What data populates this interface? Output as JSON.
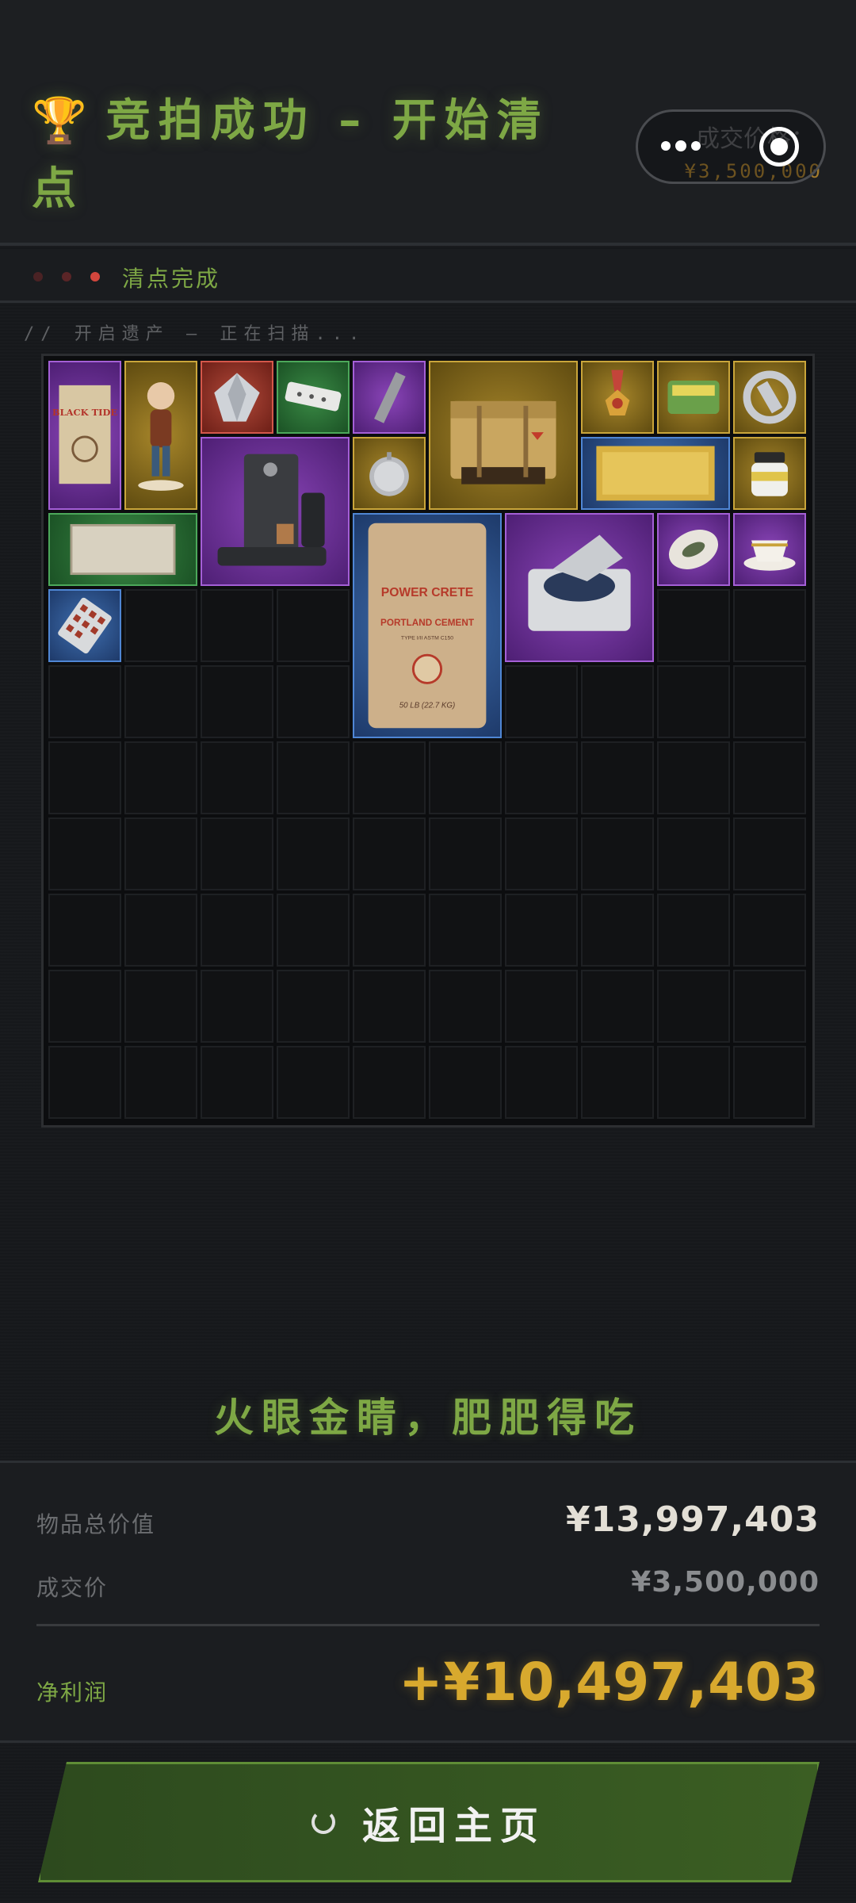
{
  "header": {
    "trophy": "🏆",
    "title": "竞拍成功 – 开始清点",
    "price_label": "成交价格：",
    "price_value": "¥3,500,000"
  },
  "status": {
    "text": "清点完成",
    "dot_colors": [
      "#4a2224",
      "#5a2527",
      "#d2463d"
    ]
  },
  "scan": {
    "text": "// 开启遗产 – 正在扫描..."
  },
  "grid": {
    "columns": 10,
    "rows": 10
  },
  "items": [
    {
      "name": "black-tide-book",
      "rarity": "purple",
      "label": "BLACK TIDE"
    },
    {
      "name": "figurine",
      "rarity": "gold"
    },
    {
      "name": "diamond",
      "rarity": "red"
    },
    {
      "name": "power-strip",
      "rarity": "green"
    },
    {
      "name": "memory-stick",
      "rarity": "purple"
    },
    {
      "name": "military-crate",
      "rarity": "gold"
    },
    {
      "name": "medal",
      "rarity": "gold"
    },
    {
      "name": "tin-can",
      "rarity": "gold"
    },
    {
      "name": "ring-emblem",
      "rarity": "gold"
    },
    {
      "name": "coffee-machine",
      "rarity": "purple"
    },
    {
      "name": "pocket-watch",
      "rarity": "gold"
    },
    {
      "name": "gold-bar",
      "rarity": "blue"
    },
    {
      "name": "jar",
      "rarity": "gold"
    },
    {
      "name": "wood-panel",
      "rarity": "green"
    },
    {
      "name": "cement-bag",
      "rarity": "blue",
      "lines": [
        "POWER CRETE",
        "PORTLAND CEMENT",
        "TYPE I/II ASTM C150",
        "50 LB (22.7 KG)"
      ]
    },
    {
      "name": "centrifuge",
      "rarity": "purple"
    },
    {
      "name": "decorated-egg",
      "rarity": "purple"
    },
    {
      "name": "teacup",
      "rarity": "purple"
    },
    {
      "name": "pill-blister",
      "rarity": "blue"
    }
  ],
  "slogan": "火眼金睛，肥肥得吃",
  "summary": {
    "total_label": "物品总价值",
    "total_value": "¥13,997,403",
    "deal_label": "成交价",
    "deal_value": "¥3,500,000",
    "profit_label": "净利润",
    "profit_value": "+¥10,497,403"
  },
  "button": {
    "label": "返回主页"
  },
  "colors": {
    "accent_green": "#7ea845",
    "gold": "#d8a92e",
    "purple": "#8a45b8",
    "blue": "#3f6fb0",
    "red": "#b34a3a"
  }
}
